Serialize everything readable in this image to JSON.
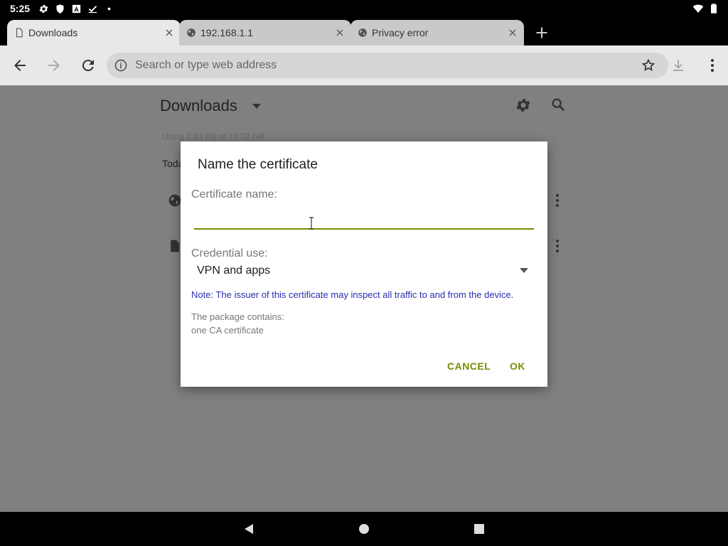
{
  "status_bar": {
    "time": "5:25"
  },
  "tabs": [
    {
      "title": "Downloads",
      "icon": "page-icon",
      "active": true
    },
    {
      "title": "192.168.1.1",
      "icon": "globe-icon",
      "active": false
    },
    {
      "title": "Privacy error",
      "icon": "globe-icon",
      "active": false
    }
  ],
  "toolbar": {
    "omnibox_placeholder": "Search or type web address"
  },
  "downloads": {
    "title": "Downloads",
    "storage": "Using 2.83 KB of 73.32 GB",
    "section": "Toda"
  },
  "dialog": {
    "title": "Name the certificate",
    "name_label": "Certificate name:",
    "name_value": "",
    "use_label": "Credential use:",
    "use_value": "VPN and apps",
    "note": "Note: The issuer of this certificate may inspect all traffic to and from the device.",
    "package_line1": "The package contains:",
    "package_line2": "one CA certificate",
    "cancel": "CANCEL",
    "ok": "OK"
  },
  "colors": {
    "accent": "#7a8c00",
    "note": "#2b2bb0",
    "scrim": "#808080"
  }
}
